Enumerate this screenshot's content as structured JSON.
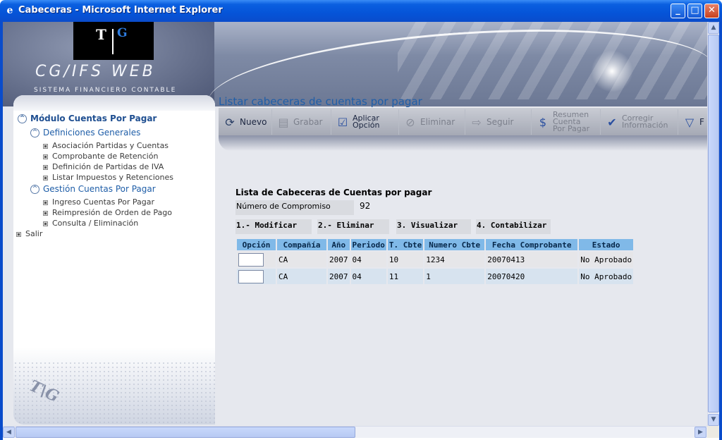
{
  "window": {
    "title": "Cabeceras - Microsoft Internet Explorer"
  },
  "banner": {
    "logo_t": "T",
    "logo_g": "G",
    "brand": "CG/IFS WEB",
    "brand_sub": "SISTEMA FINANCIERO CONTABLE"
  },
  "sidebar": {
    "module": "Módulo Cuentas Por Pagar",
    "groups": [
      {
        "label": "Definiciones Generales",
        "items": [
          "Asociación Partidas y Cuentas",
          "Comprobante de Retención",
          "Definición de Partidas de IVA",
          "Listar Impuestos y Retenciones"
        ]
      },
      {
        "label": "Gestión Cuentas Por Pagar",
        "items": [
          "Ingreso Cuentas Por Pagar",
          "Reimpresión de Orden de Pago",
          "Consulta / Eliminación"
        ]
      }
    ],
    "exit": "Salir"
  },
  "header": {
    "title": "Listar cabeceras de cuentas por pagar"
  },
  "toolbar": {
    "nuevo": "Nuevo",
    "grabar": "Grabar",
    "aplicar_1": "Aplicar",
    "aplicar_2": "Opción",
    "eliminar": "Eliminar",
    "seguir": "Seguir",
    "resumen_1": "Resumen",
    "resumen_2": "Cuenta",
    "resumen_3": "Por Pagar",
    "corregir_1": "Corregir",
    "corregir_2": "Información",
    "last": "F"
  },
  "content": {
    "list_title": "Lista de Cabeceras de Cuentas por pagar",
    "compromiso_label": "Número de Compromiso",
    "compromiso_value": "92",
    "actions": [
      "1.- Modificar",
      "2.- Eliminar",
      "3. Visualizar",
      "4. Contabilizar"
    ],
    "columns": [
      "Opción",
      "Compañía",
      "Año",
      "Periodo",
      "T. Cbte",
      "Numero Cbte",
      "Fecha Comprobante",
      "Estado"
    ],
    "rows": [
      [
        "",
        "CA",
        "2007",
        "04",
        "10",
        "1234",
        "20070413",
        "No Aprobado"
      ],
      [
        "",
        "CA",
        "2007",
        "04",
        "11",
        "1",
        "20070420",
        "No Aprobado"
      ]
    ]
  }
}
